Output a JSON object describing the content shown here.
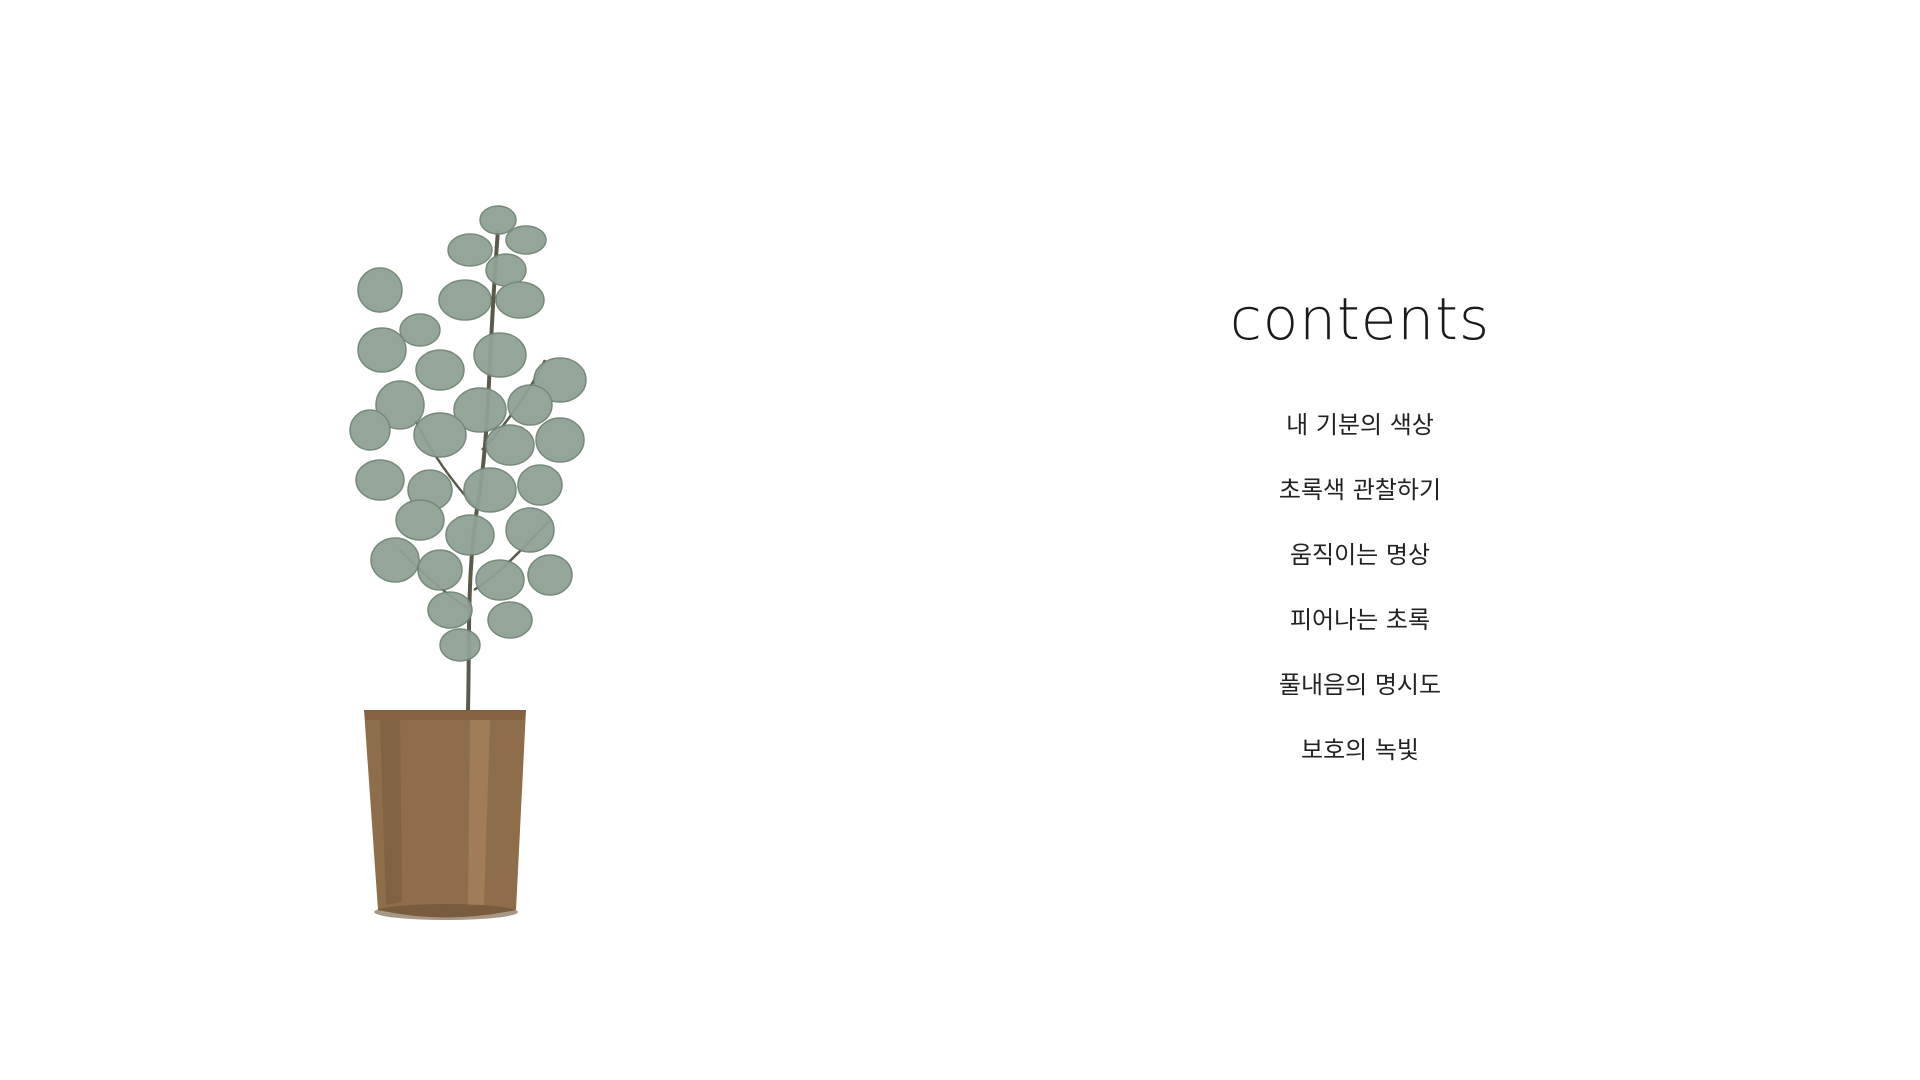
{
  "toc": {
    "title": "contents",
    "items": [
      {
        "label": "내 기분의 색상"
      },
      {
        "label": "초록색 관찰하기"
      },
      {
        "label": "움직이는 명상"
      },
      {
        "label": "피어나는 초록"
      },
      {
        "label": "풀내음의 명시도"
      },
      {
        "label": "보호의 녹빛"
      }
    ]
  },
  "colors": {
    "background": "#ffffff",
    "leaf": "#8fa294",
    "leaf_dark": "#6f8474",
    "pot": "#8e6d4a",
    "stem": "#5a5a4a"
  },
  "illustration": {
    "icon": "potted-plant-illustration"
  }
}
